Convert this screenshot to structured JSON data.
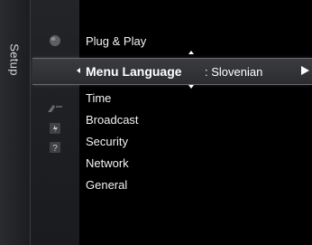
{
  "side_tab": {
    "label": "Setup"
  },
  "categories": [
    {
      "icon": "picture-icon"
    },
    {
      "icon": "setup-gear-icon"
    },
    {
      "icon": "input-icon"
    },
    {
      "icon": "application-icon"
    },
    {
      "icon": "support-icon"
    }
  ],
  "menu": {
    "items": [
      {
        "label": "Plug & Play"
      },
      {
        "label": "Menu Language",
        "value": ": Slovenian",
        "selected": true
      },
      {
        "label": "Time"
      },
      {
        "label": "Broadcast"
      },
      {
        "label": "Security"
      },
      {
        "label": "Network"
      },
      {
        "label": "General"
      }
    ]
  },
  "colors": {
    "background": "#000000",
    "highlight": "#3b3c40",
    "text": "#f2f2f2"
  }
}
